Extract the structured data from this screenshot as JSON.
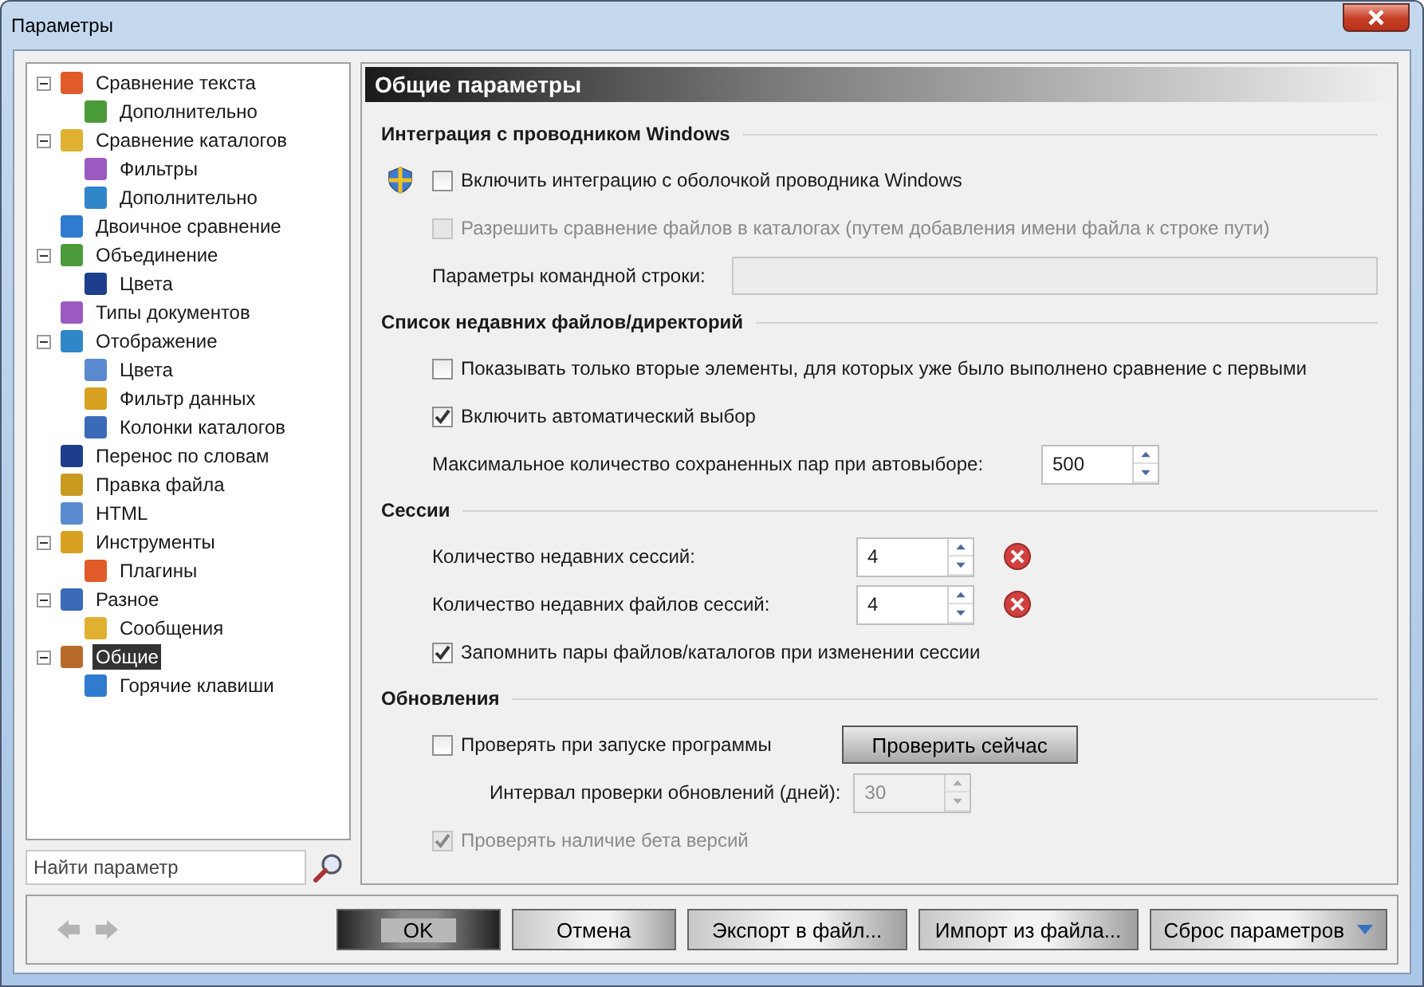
{
  "window": {
    "title": "Параметры"
  },
  "tree": [
    {
      "label": "Сравнение текста",
      "selected": false,
      "expanded": true,
      "children": [
        {
          "label": "Дополнительно",
          "selected": false
        }
      ]
    },
    {
      "label": "Сравнение каталогов",
      "selected": false,
      "expanded": true,
      "children": [
        {
          "label": "Фильтры",
          "selected": false
        },
        {
          "label": "Дополнительно",
          "selected": false
        }
      ]
    },
    {
      "label": "Двоичное сравнение",
      "selected": false
    },
    {
      "label": "Объединение",
      "selected": false,
      "expanded": true,
      "children": [
        {
          "label": "Цвета",
          "selected": false
        }
      ]
    },
    {
      "label": "Типы документов",
      "selected": false
    },
    {
      "label": "Отображение",
      "selected": false,
      "expanded": true,
      "children": [
        {
          "label": "Цвета",
          "selected": false
        },
        {
          "label": "Фильтр данных",
          "selected": false
        },
        {
          "label": "Колонки каталогов",
          "selected": false
        }
      ]
    },
    {
      "label": "Перенос по словам",
      "selected": false
    },
    {
      "label": "Правка файла",
      "selected": false
    },
    {
      "label": "HTML",
      "selected": false
    },
    {
      "label": "Инструменты",
      "selected": false,
      "expanded": true,
      "children": [
        {
          "label": "Плагины",
          "selected": false
        }
      ]
    },
    {
      "label": "Разное",
      "selected": false,
      "expanded": true,
      "children": [
        {
          "label": "Сообщения",
          "selected": false
        }
      ]
    },
    {
      "label": "Общие",
      "selected": true,
      "expanded": true,
      "children": [
        {
          "label": "Горячие клавиши",
          "selected": false
        }
      ]
    }
  ],
  "search": {
    "placeholder": "Найти параметр"
  },
  "panel": {
    "title": "Общие параметры",
    "sections": [
      {
        "title": "Интеграция с проводником Windows",
        "rows": [
          {
            "kind": "shieldcheck",
            "label": "Включить интеграцию с оболочкой проводника Windows",
            "checked": false,
            "disabled": false
          },
          {
            "kind": "checkbox",
            "label": "Разрешить сравнение файлов в каталогах (путем добавления имени файла к строке пути)",
            "checked": false,
            "disabled": true
          },
          {
            "kind": "field",
            "label": "Параметры командной строки:",
            "disabled": true
          }
        ]
      },
      {
        "title": "Список недавних файлов/директорий",
        "rows": [
          {
            "kind": "checkbox",
            "label": "Показывать только вторые элементы, для которых уже было выполнено сравнение с первыми",
            "checked": false,
            "disabled": false
          },
          {
            "kind": "checkbox",
            "label": "Включить автоматический выбор",
            "checked": true,
            "disabled": false
          },
          {
            "kind": "spin",
            "label": "Максимальное количество сохраненных пар при автовыборе:",
            "value": "500",
            "disabled": false
          }
        ]
      },
      {
        "title": "Сессии",
        "rows": [
          {
            "kind": "spin",
            "label": "Количество недавних сессий:",
            "value": "4",
            "disabled": false,
            "clearable": true
          },
          {
            "kind": "spin",
            "label": "Количество недавних файлов сессий:",
            "value": "4",
            "disabled": false,
            "clearable": true
          },
          {
            "kind": "checkbox",
            "label": "Запомнить пары файлов/каталогов при изменении сессии",
            "checked": true,
            "disabled": false
          }
        ]
      },
      {
        "title": "Обновления",
        "rows": [
          {
            "kind": "checkbutton",
            "label": "Проверять при запуске программы",
            "checked": false,
            "disabled": false,
            "button": "Проверить сейчас"
          },
          {
            "kind": "subspin",
            "label": "Интервал проверки обновлений (дней):",
            "value": "30",
            "disabled": true
          },
          {
            "kind": "checkbox",
            "label": "Проверять наличие бета версий",
            "checked": true,
            "disabled": true
          }
        ]
      }
    ]
  },
  "buttons": [
    {
      "label": "OK",
      "default": true,
      "dropdown": false
    },
    {
      "label": "Отмена",
      "default": false,
      "dropdown": false
    },
    {
      "label": "Экспорт в файл...",
      "default": false,
      "dropdown": false
    },
    {
      "label": "Импорт из файла...",
      "default": false,
      "dropdown": false
    },
    {
      "label": "Сброс параметров",
      "default": false,
      "dropdown": true
    }
  ]
}
